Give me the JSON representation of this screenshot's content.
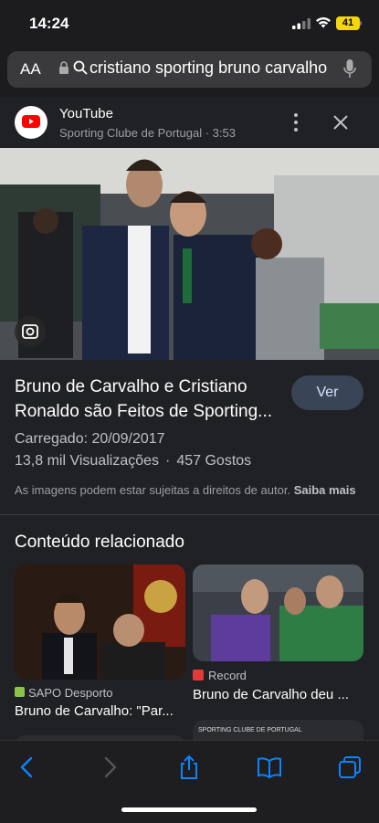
{
  "status": {
    "time": "14:24",
    "battery": "41"
  },
  "urlbar": {
    "aa_label": "AA",
    "query": "cristiano sporting bruno carvalho"
  },
  "result": {
    "source": "YouTube",
    "channel": "Sporting Clube de Portugal · 3:53",
    "headline": "Bruno de Carvalho e Cristiano Ronaldo são Feitos de Sporting...",
    "button": "Ver",
    "uploaded": "Carregado: 20/09/2017",
    "views": "13,8 mil Visualizações",
    "likes": "457 Gostos",
    "rights": "As imagens podem estar sujeitas a direitos de autor.",
    "learn_more": "Saiba mais"
  },
  "related": {
    "title": "Conteúdo relacionado",
    "cards": [
      {
        "source": "SAPO Desporto",
        "title": "Bruno de Carvalho: \"Par..."
      },
      {
        "source": "Record",
        "title": "Bruno de Carvalho deu ..."
      }
    ],
    "partial_card_text": "SPORTING CLUBE DE PORTUGAL"
  },
  "colors": {
    "accent": "#0a84ff",
    "button_bg": "#394457",
    "youtube_red": "#ff0000"
  }
}
